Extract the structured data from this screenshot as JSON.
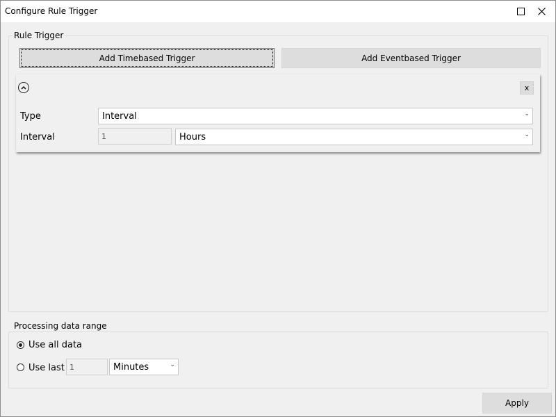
{
  "window": {
    "title": "Configure Rule Trigger"
  },
  "rule_trigger": {
    "group_label": "Rule Trigger",
    "add_timebased_label": "Add Timebased Trigger",
    "add_eventbased_label": "Add Eventbased Trigger",
    "trigger_card": {
      "close_label": "x",
      "type_label": "Type",
      "type_value": "Interval",
      "interval_label": "Interval",
      "interval_value": "1",
      "interval_unit": "Hours"
    }
  },
  "processing": {
    "group_label": "Processing data range",
    "use_all_label": "Use all data",
    "use_last_label": "Use last",
    "use_last_value": "1",
    "use_last_unit": "Minutes",
    "selected": "use_all"
  },
  "apply_label": "Apply",
  "icons": {
    "maximize": "maximize-icon",
    "close": "close-icon",
    "collapse": "chevron-up-circle-icon",
    "dropdown": "chevron-down-icon"
  }
}
